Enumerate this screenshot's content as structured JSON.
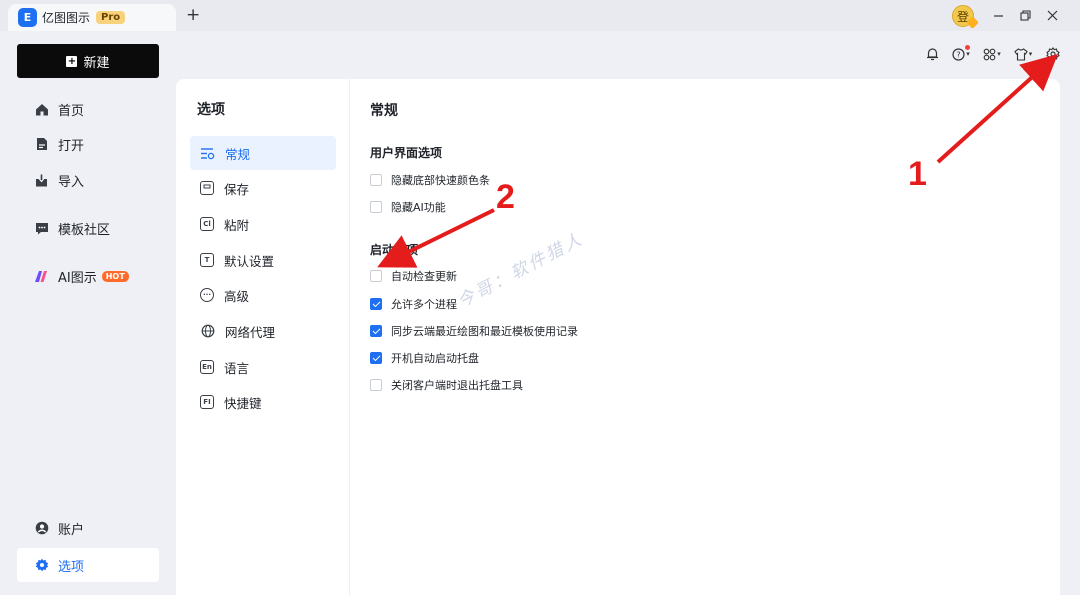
{
  "window": {
    "app_name": "亿图图示",
    "app_logo_glyph": "E",
    "edition_badge": "Pro",
    "new_tab_glyph": "+",
    "avatar_text": "登",
    "accent_color": "#1e6ff2"
  },
  "sidebar": {
    "new_button_label": "新建",
    "nav": [
      {
        "label": "首页",
        "icon": "home-icon"
      },
      {
        "label": "打开",
        "icon": "file-icon"
      },
      {
        "label": "导入",
        "icon": "import-icon"
      },
      {
        "label": "模板社区",
        "icon": "community-icon"
      },
      {
        "label": "AI图示",
        "icon": "ai-icon",
        "badge": "HOT"
      }
    ],
    "bottom": [
      {
        "label": "账户",
        "icon": "account-icon"
      },
      {
        "label": "选项",
        "icon": "gear-icon",
        "active": true
      }
    ]
  },
  "options": {
    "title": "选项",
    "items": [
      {
        "label": "常规",
        "icon": "general-icon",
        "active": true
      },
      {
        "label": "保存",
        "icon": "save-icon"
      },
      {
        "label": "粘附",
        "icon": "snap-icon",
        "glyph": "Cl"
      },
      {
        "label": "默认设置",
        "icon": "default-settings-icon",
        "glyph": "T"
      },
      {
        "label": "高级",
        "icon": "advanced-icon",
        "glyph": "···"
      },
      {
        "label": "网络代理",
        "icon": "proxy-icon"
      },
      {
        "label": "语言",
        "icon": "language-icon",
        "glyph": "En"
      },
      {
        "label": "快捷键",
        "icon": "shortcut-icon",
        "glyph": "FI"
      }
    ]
  },
  "settings": {
    "section_title": "常规",
    "ui_group": {
      "title": "用户界面选项",
      "options": [
        {
          "label": "隐藏底部快速颜色条",
          "checked": false
        },
        {
          "label": "隐藏AI功能",
          "checked": false
        }
      ]
    },
    "startup_group": {
      "title": "启动选项",
      "options": [
        {
          "label": "自动检查更新",
          "checked": false
        },
        {
          "label": "允许多个进程",
          "checked": true
        },
        {
          "label": "同步云端最近绘图和最近模板使用记录",
          "checked": true
        },
        {
          "label": "开机自动启动托盘",
          "checked": true
        },
        {
          "label": "关闭客户端时退出托盘工具",
          "checked": false
        }
      ]
    }
  },
  "annotations": {
    "marker_1": "1",
    "marker_2": "2",
    "watermark": "今哥：软件猎人",
    "color": "#e41c1c"
  }
}
